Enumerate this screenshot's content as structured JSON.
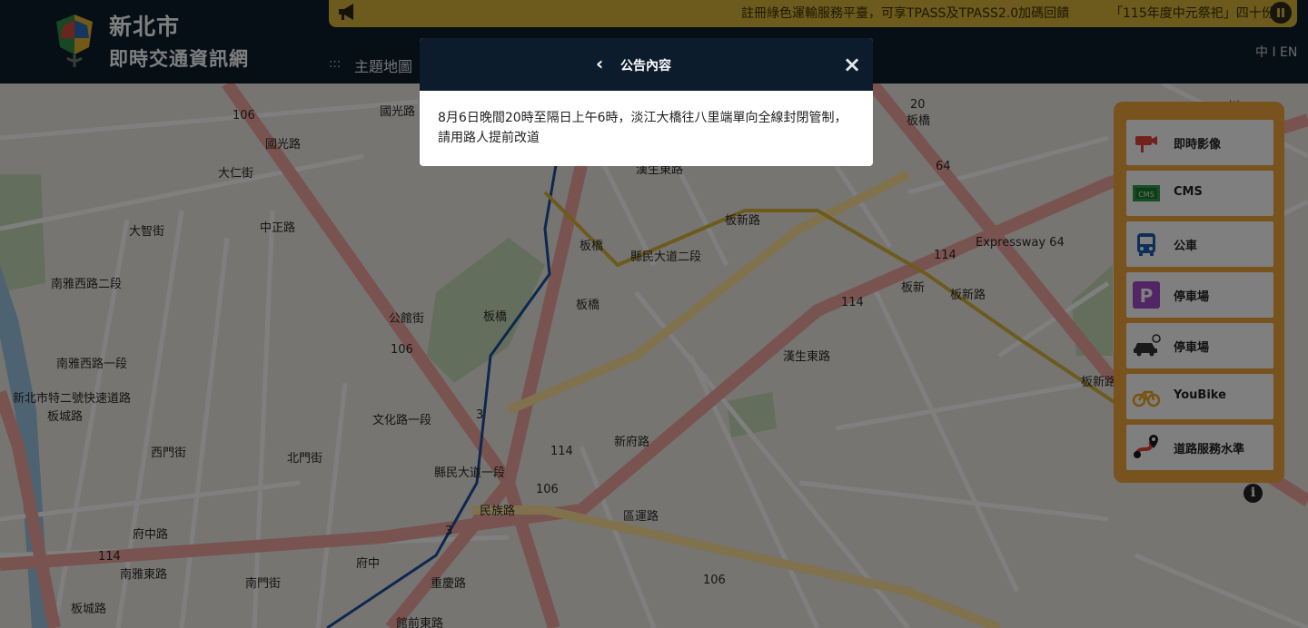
{
  "header": {
    "brand_line1": "新北市",
    "brand_line2": "即時交通資訊網",
    "marquee_text": "註冊綠色運輸服務平臺，可享TPASS及TPASS2.0加碼回饋",
    "marquee_text2": "「115年度中元祭祀」四十份",
    "nav_dots": ":::",
    "nav_item": "主題地圖",
    "lang": "中 I EN",
    "accent_color": "#d9b63a",
    "bg_color": "#0d1c2d"
  },
  "modal": {
    "back_icon": "‹",
    "title": "公告內容",
    "close_icon": "×",
    "body": "8月6日晚間20時至隔日上午6時，淡江大橋往八里端單向全線封閉管制，請用路人提前改道"
  },
  "panel": {
    "items": [
      {
        "label": "即時影像",
        "icon": "camera-icon"
      },
      {
        "label": "CMS",
        "icon": "cms-icon"
      },
      {
        "label": "公車",
        "icon": "bus-icon"
      },
      {
        "label": "停車場",
        "icon": "parking-icon"
      },
      {
        "label": "停車場",
        "icon": "car-parking-icon"
      },
      {
        "label": "YouBike",
        "icon": "bike-icon"
      },
      {
        "label": "道路服務水準",
        "icon": "road-service-icon"
      }
    ],
    "color": "#f0a63a"
  },
  "map": {
    "labels": [
      "106",
      "國光路",
      "國光路",
      "大仁街",
      "大智街",
      "中正路",
      "南雅西路二段",
      "南雅西路一段",
      "公館街",
      "106",
      "文化路一段",
      "北門街",
      "西門街",
      "府中路",
      "南雅東路",
      "114",
      "府中",
      "南門街",
      "重慶路",
      "館前東路",
      "板橋",
      "板橋",
      "板橋",
      "縣民大道二段",
      "縣民大道一段",
      "3",
      "114",
      "106",
      "民族路",
      "3",
      "新府路",
      "區運路",
      "106",
      "漢生東路",
      "漢生東路",
      "板新路",
      "114",
      "板新",
      "板新路",
      "Expressway 64",
      "114",
      "板新路",
      "20",
      "板橋",
      "64",
      "新北市特二號快速道路",
      "板城路",
      "板城路",
      "川"
    ]
  }
}
